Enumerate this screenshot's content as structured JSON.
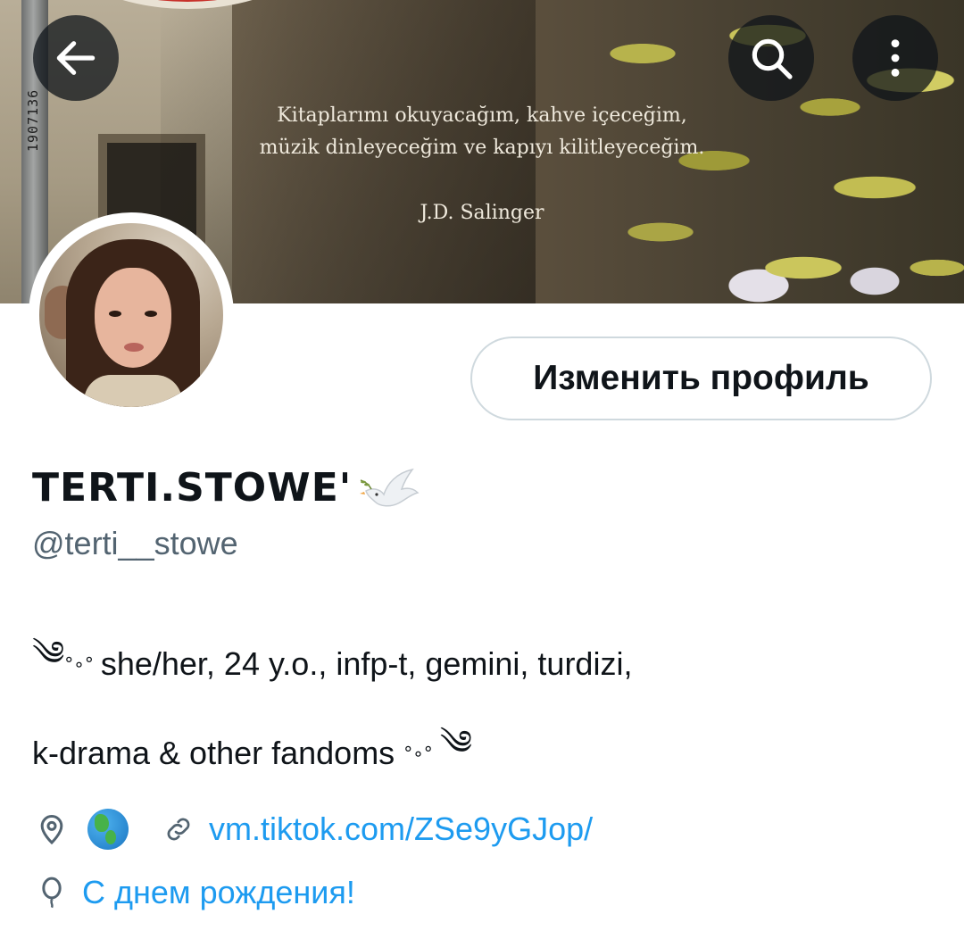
{
  "banner": {
    "pole_label": "1907136",
    "quote_line1": "Kitaplarımı okuyacağım, kahve içeceğim,",
    "quote_line2": "müzik dinleyeceğim ve kapıyı kilitleyeceğim.",
    "quote_author": "J.D. Salinger"
  },
  "toolbar": {
    "back_icon": "arrow-left-icon",
    "search_icon": "search-icon",
    "more_icon": "more-vertical-icon"
  },
  "profile": {
    "edit_button_label": "Изменить профиль",
    "display_name": "TERTI.STOWE'",
    "handle": "@terti__stowe",
    "bio_line1_prefix": "༄",
    "bio_line1_small": "°∘°",
    "bio_line1_text": "she/her, 24 y.o., infp-t, gemini, turdizi,",
    "bio_line2_text": "k-drama & other fandoms",
    "bio_line2_small": "°∘°",
    "bio_line2_suffix": "༄",
    "link_text": "vm.tiktok.com/ZSe9yGJop/",
    "birthday_text": "С днем рождения!"
  },
  "colors": {
    "link": "#1d9bf0",
    "text_primary": "#0f1419",
    "text_secondary": "#536471",
    "button_border": "#cfd9de"
  }
}
